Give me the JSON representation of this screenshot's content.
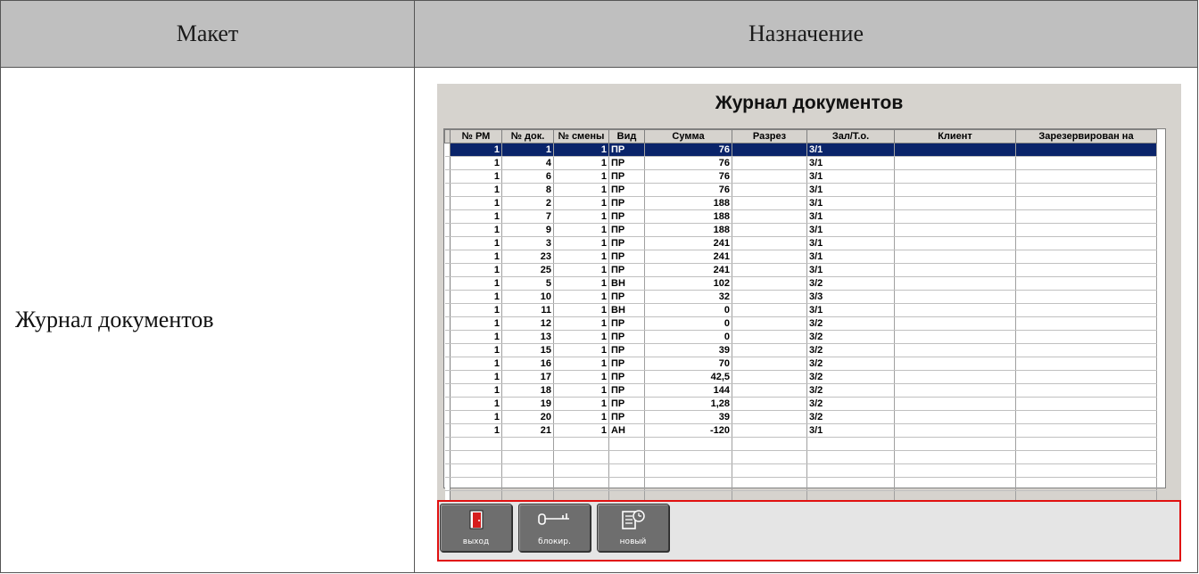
{
  "header": {
    "left": "Макет",
    "right": "Назначение"
  },
  "left_cell_text": "Журнал документов",
  "app": {
    "title": "Журнал документов",
    "columns": [
      "№ РМ",
      "№ док.",
      "№ смены",
      "Вид",
      "Сумма",
      "Разрез",
      "Зал/Т.о.",
      "Клиент",
      "Зарезервирован на"
    ],
    "selected_row": 0,
    "rows": [
      [
        "1",
        "1",
        "1",
        "ПР",
        "76",
        "",
        "3/1",
        "",
        ""
      ],
      [
        "1",
        "4",
        "1",
        "ПР",
        "76",
        "",
        "3/1",
        "",
        ""
      ],
      [
        "1",
        "6",
        "1",
        "ПР",
        "76",
        "",
        "3/1",
        "",
        ""
      ],
      [
        "1",
        "8",
        "1",
        "ПР",
        "76",
        "",
        "3/1",
        "",
        ""
      ],
      [
        "1",
        "2",
        "1",
        "ПР",
        "188",
        "",
        "3/1",
        "",
        ""
      ],
      [
        "1",
        "7",
        "1",
        "ПР",
        "188",
        "",
        "3/1",
        "",
        ""
      ],
      [
        "1",
        "9",
        "1",
        "ПР",
        "188",
        "",
        "3/1",
        "",
        ""
      ],
      [
        "1",
        "3",
        "1",
        "ПР",
        "241",
        "",
        "3/1",
        "",
        ""
      ],
      [
        "1",
        "23",
        "1",
        "ПР",
        "241",
        "",
        "3/1",
        "",
        ""
      ],
      [
        "1",
        "25",
        "1",
        "ПР",
        "241",
        "",
        "3/1",
        "",
        ""
      ],
      [
        "1",
        "5",
        "1",
        "ВН",
        "102",
        "",
        "3/2",
        "",
        ""
      ],
      [
        "1",
        "10",
        "1",
        "ПР",
        "32",
        "",
        "3/3",
        "",
        ""
      ],
      [
        "1",
        "11",
        "1",
        "ВН",
        "0",
        "",
        "3/1",
        "",
        ""
      ],
      [
        "1",
        "12",
        "1",
        "ПР",
        "0",
        "",
        "3/2",
        "",
        ""
      ],
      [
        "1",
        "13",
        "1",
        "ПР",
        "0",
        "",
        "3/2",
        "",
        ""
      ],
      [
        "1",
        "15",
        "1",
        "ПР",
        "39",
        "",
        "3/2",
        "",
        ""
      ],
      [
        "1",
        "16",
        "1",
        "ПР",
        "70",
        "",
        "3/2",
        "",
        ""
      ],
      [
        "1",
        "17",
        "1",
        "ПР",
        "42,5",
        "",
        "3/2",
        "",
        ""
      ],
      [
        "1",
        "18",
        "1",
        "ПР",
        "144",
        "",
        "3/2",
        "",
        ""
      ],
      [
        "1",
        "19",
        "1",
        "ПР",
        "1,28",
        "",
        "3/2",
        "",
        ""
      ],
      [
        "1",
        "20",
        "1",
        "ПР",
        "39",
        "",
        "3/2",
        "",
        ""
      ],
      [
        "1",
        "21",
        "1",
        "АН",
        "-120",
        "",
        "3/1",
        "",
        ""
      ]
    ],
    "toolbar": [
      {
        "label": "выход",
        "icon": "exit-door-icon"
      },
      {
        "label": "блокир.",
        "icon": "key-lock-icon"
      },
      {
        "label": "новый",
        "icon": "new-document-icon"
      }
    ],
    "colors": {
      "selection": "#0a246a",
      "panel": "#d6d3ce",
      "toolbar_border": "#e01010",
      "button": "#6e6e6e"
    }
  }
}
